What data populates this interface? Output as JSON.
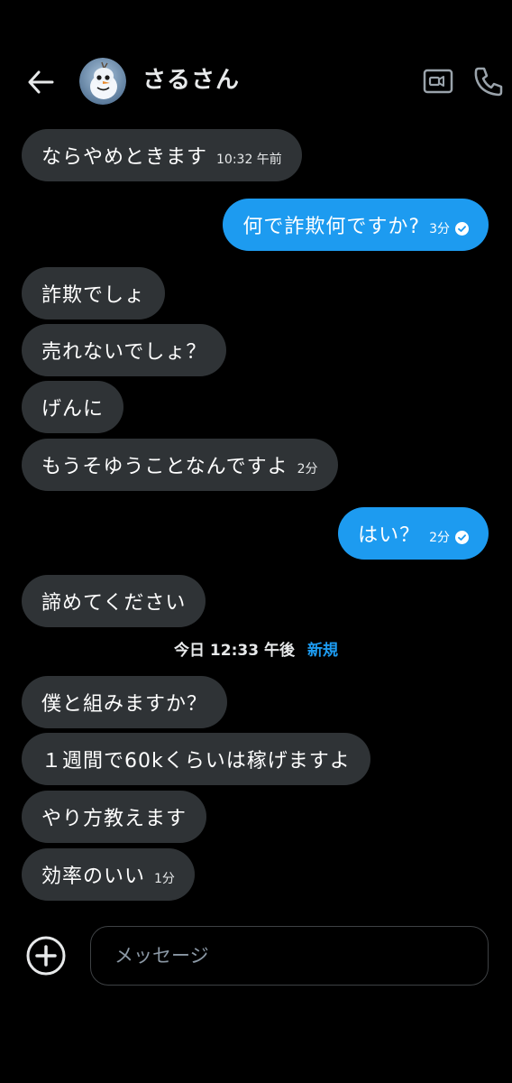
{
  "header": {
    "contact_name": "さるさん",
    "avatar_icon": "snowman-avatar",
    "back_icon": "arrow-left-icon",
    "video_icon": "video-camera-icon",
    "call_icon": "phone-icon"
  },
  "messages": [
    {
      "direction": "in",
      "text": "ならやめときます",
      "time": "10:32 午前"
    },
    {
      "direction": "out",
      "text": "何で詐欺何ですか?",
      "time": "3分",
      "status": "sent"
    },
    {
      "direction": "in",
      "text": "詐欺でしょ"
    },
    {
      "direction": "in",
      "text": "売れないでしょ？"
    },
    {
      "direction": "in",
      "text": "げんに"
    },
    {
      "direction": "in",
      "text": "もうそゆうことなんですよ",
      "time": "2分"
    },
    {
      "direction": "out",
      "text": "はい？",
      "time": "2分",
      "status": "sent"
    },
    {
      "direction": "in",
      "text": "諦めてください"
    },
    {
      "direction": "in",
      "text": "僕と組みますか？"
    },
    {
      "direction": "in",
      "text": "１週間で60kくらいは稼げますよ"
    },
    {
      "direction": "in",
      "text": "やり方教えます"
    },
    {
      "direction": "in",
      "text": "効率のいい",
      "time": "1分"
    }
  ],
  "divider": {
    "date": "今日 12:33 午後",
    "new_label": "新規"
  },
  "composer": {
    "placeholder": "メッセージ",
    "value": "",
    "add_icon": "plus-circle-icon"
  },
  "colors": {
    "background": "#000000",
    "incoming_bubble": "#2f3336",
    "outgoing_bubble": "#1d9bf0",
    "accent": "#1d9bf0"
  }
}
